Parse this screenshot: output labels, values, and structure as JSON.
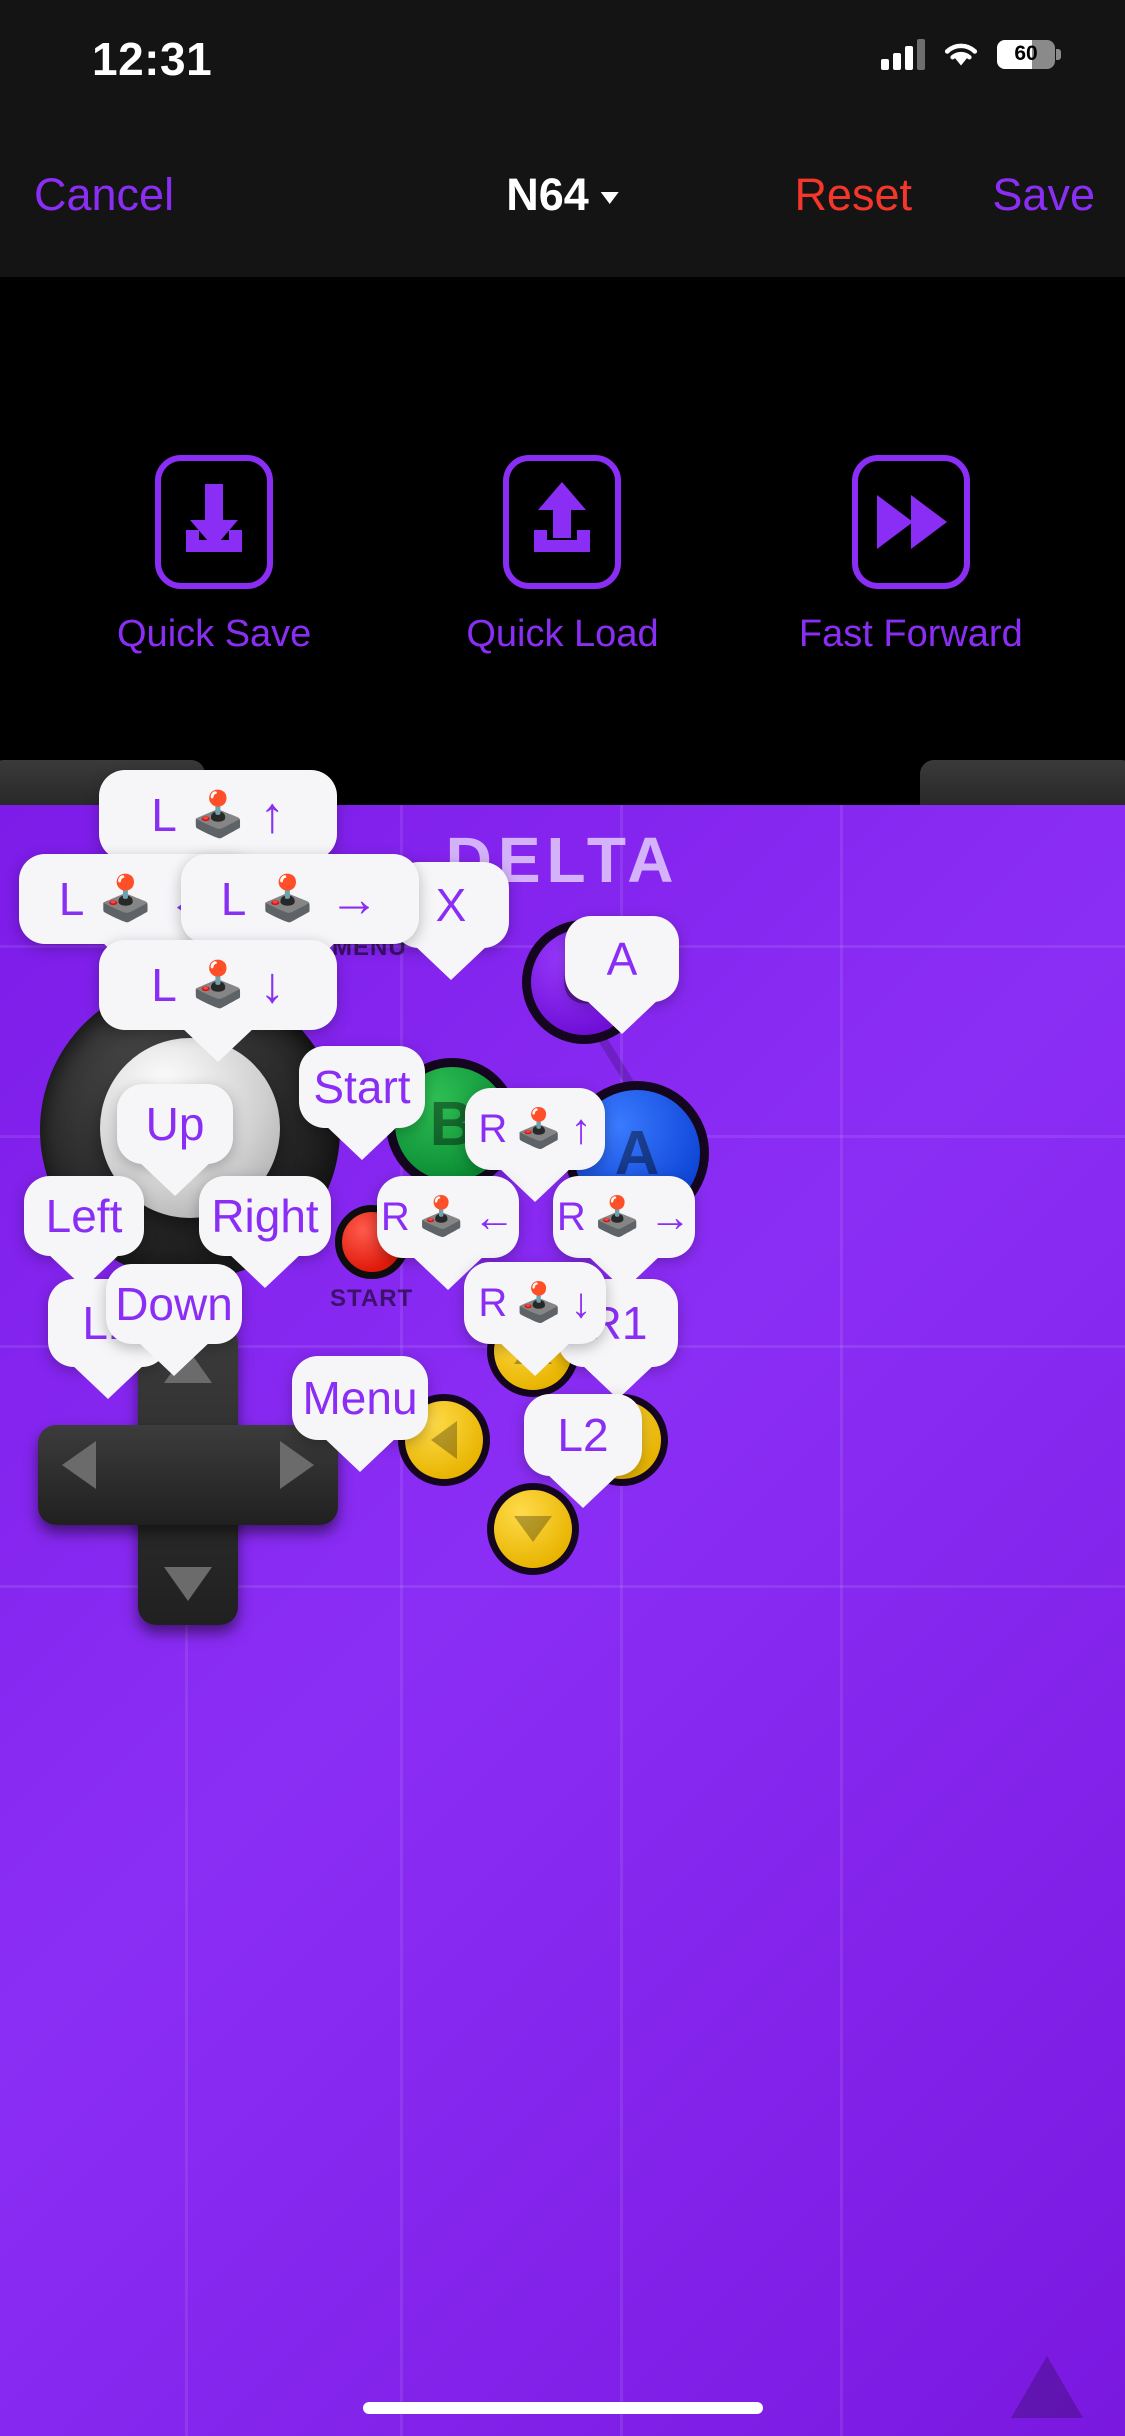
{
  "status_bar": {
    "time": "12:31",
    "battery_percent": "60",
    "signal_icon": "cellular-bars-icon",
    "wifi_icon": "wifi-icon",
    "battery_icon": "battery-icon"
  },
  "nav_bar": {
    "cancel_label": "Cancel",
    "title": "N64",
    "title_caret_icon": "chevron-down-icon",
    "reset_label": "Reset",
    "save_label": "Save"
  },
  "actions": [
    {
      "label": "Quick Save",
      "icon": "download-tray-icon"
    },
    {
      "label": "Quick Load",
      "icon": "upload-tray-icon"
    },
    {
      "label": "Fast Forward",
      "icon": "fast-forward-icon"
    }
  ],
  "skin": {
    "brand_word": "DELTA",
    "menu_button_label": "MENU",
    "start_button_label": "START",
    "face_buttons": [
      {
        "name": "c-button",
        "label": "C",
        "color": "#8b2ef5"
      },
      {
        "name": "b-button",
        "label": "B",
        "color": "#159e3c"
      },
      {
        "name": "a-button",
        "label": "A",
        "color": "#1a56e8"
      }
    ]
  },
  "callouts": [
    {
      "id": "l1",
      "text": "L1",
      "stick": "",
      "dir": ""
    },
    {
      "id": "r1",
      "text": "R1",
      "stick": "",
      "dir": ""
    },
    {
      "id": "l2",
      "text": "L2",
      "stick": "",
      "dir": ""
    },
    {
      "id": "menu",
      "text": "Menu",
      "stick": "",
      "dir": ""
    },
    {
      "id": "x",
      "text": "X",
      "stick": "",
      "dir": ""
    },
    {
      "id": "a",
      "text": "A",
      "stick": "",
      "dir": ""
    },
    {
      "id": "start",
      "text": "Start",
      "stick": "",
      "dir": ""
    },
    {
      "id": "up",
      "text": "Up",
      "stick": "",
      "dir": ""
    },
    {
      "id": "left",
      "text": "Left",
      "stick": "",
      "dir": ""
    },
    {
      "id": "right",
      "text": "Right",
      "stick": "",
      "dir": ""
    },
    {
      "id": "down",
      "text": "Down",
      "stick": "",
      "dir": ""
    },
    {
      "id": "lstick-up",
      "text": "L",
      "stick": "🕹️",
      "dir": "↑"
    },
    {
      "id": "lstick-left",
      "text": "L",
      "stick": "🕹️",
      "dir": "←"
    },
    {
      "id": "lstick-right",
      "text": "L",
      "stick": "🕹️",
      "dir": "→"
    },
    {
      "id": "lstick-down",
      "text": "L",
      "stick": "🕹️",
      "dir": "↓"
    },
    {
      "id": "rstick-up",
      "text": "R",
      "stick": "🕹️",
      "dir": "↑"
    },
    {
      "id": "rstick-left",
      "text": "R",
      "stick": "🕹️",
      "dir": "←"
    },
    {
      "id": "rstick-right",
      "text": "R",
      "stick": "🕹️",
      "dir": "→"
    },
    {
      "id": "rstick-down",
      "text": "R",
      "stick": "🕹️",
      "dir": "↓"
    }
  ],
  "colors": {
    "accent_purple": "#8b2ef5",
    "danger_red": "#f5372b",
    "bubble_bg": "#f6f5f8",
    "skin_purple": "#7d1be8",
    "bar_background": "#141414"
  }
}
